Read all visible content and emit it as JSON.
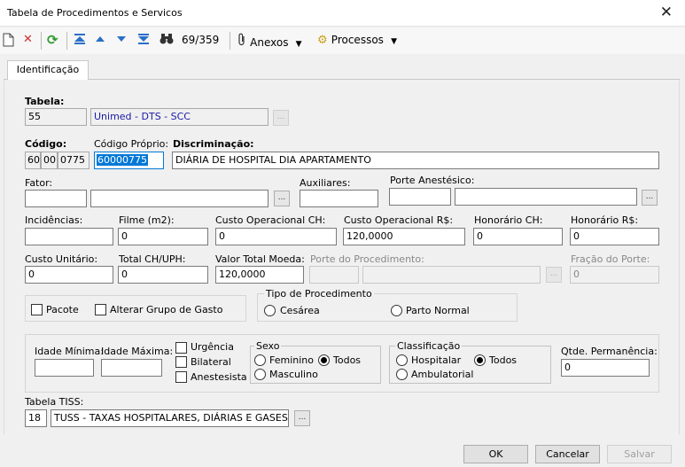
{
  "window": {
    "title": "Tabela de Procedimentos e Servicos"
  },
  "toolbar": {
    "record_counter": "69/359",
    "anexos": "Anexos",
    "processos": "Processos"
  },
  "tabs": [
    {
      "label": "Identificação"
    }
  ],
  "form": {
    "tabela": {
      "label": "Tabela:",
      "code": "55",
      "name": "Unimed - DTS - SCC"
    },
    "codigo": {
      "label": "Código:",
      "part1": "60",
      "part2": "00",
      "part3": "0775"
    },
    "codigo_proprio": {
      "label": "Código Próprio:",
      "value": "60000775"
    },
    "discriminacao": {
      "label": "Discriminação:",
      "value": "DIÁRIA DE HOSPITAL DIA APARTAMENTO"
    },
    "fator": {
      "label": "Fator:",
      "value1": "",
      "value2": ""
    },
    "auxiliares": {
      "label": "Auxiliares:",
      "value": ""
    },
    "porte_anestesico": {
      "label": "Porte Anestésico:",
      "value1": "",
      "value2": ""
    },
    "incidencias": {
      "label": "Incidências:",
      "value": ""
    },
    "filme": {
      "label": "Filme (m2):",
      "value": "0"
    },
    "custo_op_ch": {
      "label": "Custo Operacional CH:",
      "value": "0"
    },
    "custo_op_rs": {
      "label": "Custo Operacional R$:",
      "value": "120,0000"
    },
    "honorario_ch": {
      "label": "Honorário CH:",
      "value": "0"
    },
    "honorario_rs": {
      "label": "Honorário R$:",
      "value": "0"
    },
    "custo_unitario": {
      "label": "Custo Unitário:",
      "value": "0"
    },
    "total_ch_uph": {
      "label": "Total CH/UPH:",
      "value": "0"
    },
    "valor_total_moeda": {
      "label": "Valor Total Moeda:",
      "value": "120,0000"
    },
    "porte_procedimento": {
      "label": "Porte do Procedimento:",
      "value1": "",
      "value2": ""
    },
    "fracao_porte": {
      "label": "Fração do Porte:",
      "value": "0"
    },
    "pacote": {
      "label": "Pacote",
      "checked": false
    },
    "alterar_grupo": {
      "label": "Alterar Grupo de Gasto",
      "checked": false
    },
    "tipo_procedimento": {
      "legend": "Tipo de Procedimento",
      "cesarea": "Cesárea",
      "parto_normal": "Parto Normal"
    },
    "idade_minima": {
      "label": "Idade Mínima:",
      "value": ""
    },
    "idade_maxima": {
      "label": "Idade Máxima:",
      "value": ""
    },
    "urgencia": {
      "label": "Urgência",
      "checked": false
    },
    "bilateral": {
      "label": "Bilateral",
      "checked": false
    },
    "anestesista": {
      "label": "Anestesista",
      "checked": false
    },
    "sexo": {
      "legend": "Sexo",
      "feminino": "Feminino",
      "todos": "Todos",
      "masculino": "Masculino",
      "selected": "Todos"
    },
    "classificacao": {
      "legend": "Classificação",
      "hospitalar": "Hospitalar",
      "todos": "Todos",
      "ambulatorial": "Ambulatorial",
      "selected": "Todos"
    },
    "qtde_permanencia": {
      "label": "Qtde. Permanência:",
      "value": "0"
    },
    "tabela_tiss": {
      "label": "Tabela TISS:",
      "code": "18",
      "name": "TUSS - TAXAS HOSPITALARES, DIÁRIAS E GASES M"
    }
  },
  "buttons": {
    "ok": "OK",
    "cancelar": "Cancelar",
    "salvar": "Salvar"
  },
  "colors": {
    "accent": "#0078d7",
    "link_text": "#1a1aa6",
    "delete_red": "#d32f2f",
    "refresh_green": "#2e9a2e",
    "nav_blue": "#2a6fc9"
  }
}
